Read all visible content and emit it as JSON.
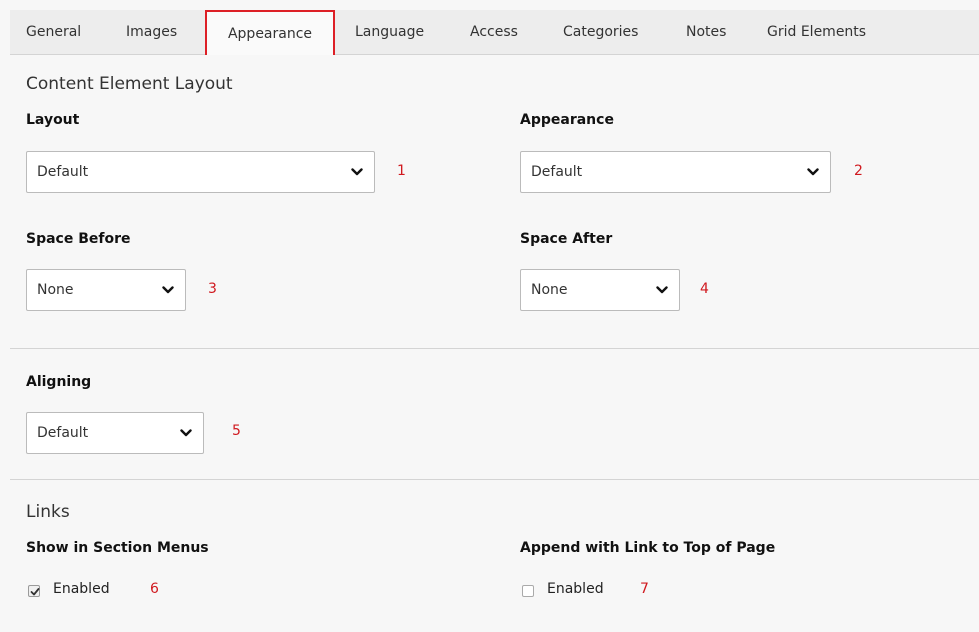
{
  "tabs": [
    {
      "label": "General"
    },
    {
      "label": "Images"
    },
    {
      "label": "Appearance"
    },
    {
      "label": "Language"
    },
    {
      "label": "Access"
    },
    {
      "label": "Categories"
    },
    {
      "label": "Notes"
    },
    {
      "label": "Grid Elements"
    }
  ],
  "active_tab": "Appearance",
  "layout_section": {
    "title": "Content Element Layout",
    "layout": {
      "label": "Layout",
      "value": "Default",
      "marker": "1"
    },
    "appearance": {
      "label": "Appearance",
      "value": "Default",
      "marker": "2"
    },
    "space_before": {
      "label": "Space Before",
      "value": "None",
      "marker": "3"
    },
    "space_after": {
      "label": "Space After",
      "value": "None",
      "marker": "4"
    }
  },
  "aligning_section": {
    "aligning": {
      "label": "Aligning",
      "value": "Default",
      "marker": "5"
    }
  },
  "links_section": {
    "title": "Links",
    "section_menus": {
      "label": "Show in Section Menus",
      "checkbox_label": "Enabled",
      "checked": true,
      "marker": "6"
    },
    "link_to_top": {
      "label": "Append with Link to Top of Page",
      "checkbox_label": "Enabled",
      "checked": false,
      "marker": "7"
    }
  },
  "colors": {
    "highlight_border": "#dd1f26",
    "marker_text": "#d0191f",
    "tab_bar": "#ededed"
  },
  "icons": {
    "select_caret": "chevron-down-icon",
    "checkbox_mark": "checkmark-icon"
  }
}
